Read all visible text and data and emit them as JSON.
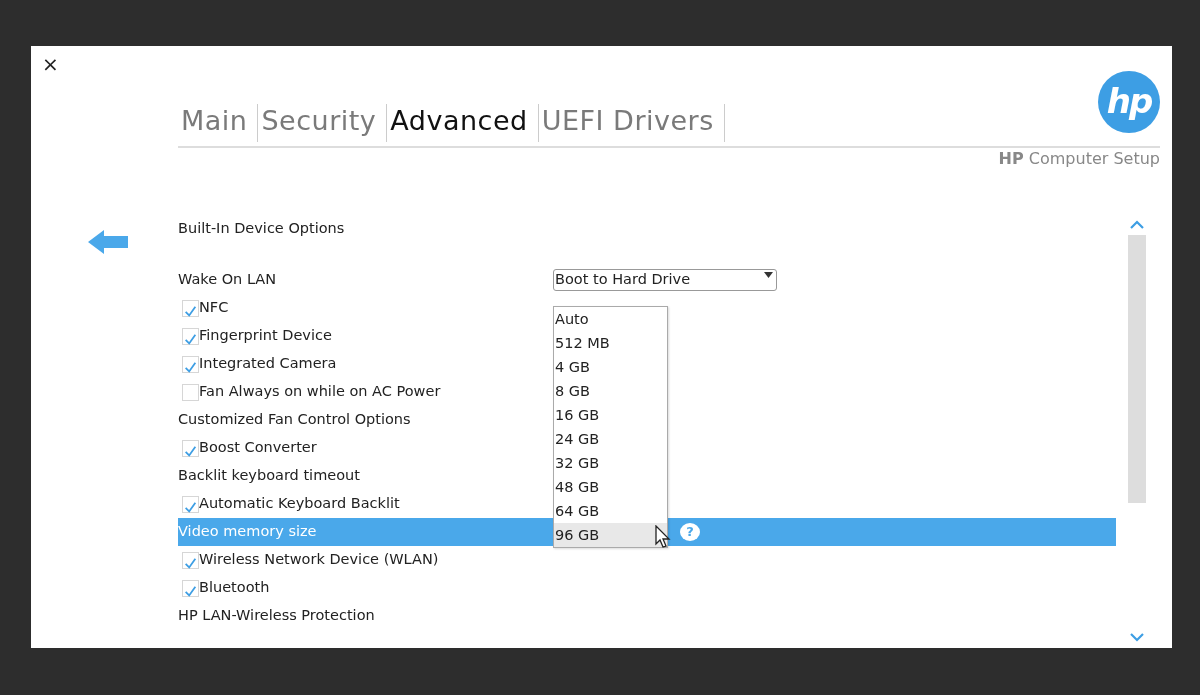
{
  "window": {
    "close": "×"
  },
  "tabs": [
    {
      "label": "Main",
      "selected": false
    },
    {
      "label": "Security",
      "selected": false
    },
    {
      "label": "Advanced",
      "selected": true
    },
    {
      "label": "UEFI Drivers",
      "selected": false
    }
  ],
  "brand": {
    "logo": "hp",
    "subtitle": "**HP** Computer Setup"
  },
  "section_title": "Built-In Device Options",
  "settings": [
    {
      "kind": "dropdown",
      "label": "Wake On LAN",
      "value": "Boot to Hard Drive",
      "selected": false
    },
    {
      "kind": "checkbox",
      "label": "NFC",
      "checked": true,
      "selected": false
    },
    {
      "kind": "checkbox",
      "label": "Fingerprint Device",
      "checked": true,
      "selected": false
    },
    {
      "kind": "checkbox",
      "label": "Integrated Camera",
      "checked": true,
      "selected": false
    },
    {
      "kind": "checkbox",
      "label": "Fan Always on while on AC Power",
      "checked": false,
      "selected": false
    },
    {
      "kind": "heading",
      "label": "Customized Fan Control Options",
      "selected": false
    },
    {
      "kind": "checkbox",
      "label": "Boost Converter",
      "checked": true,
      "selected": false
    },
    {
      "kind": "heading",
      "label": "Backlit keyboard timeout",
      "selected": false
    },
    {
      "kind": "checkbox",
      "label": "Automatic Keyboard Backlit",
      "checked": true,
      "selected": false
    },
    {
      "kind": "heading",
      "label": "Video memory size",
      "selected": true,
      "help": "?"
    },
    {
      "kind": "checkbox",
      "label": "Wireless Network Device (WLAN)",
      "checked": true,
      "selected": false
    },
    {
      "kind": "checkbox",
      "label": "Bluetooth",
      "checked": true,
      "selected": false
    },
    {
      "kind": "heading",
      "label": "HP LAN-Wireless Protection",
      "selected": false
    }
  ],
  "dropdown_list": {
    "options": [
      {
        "label": "Auto",
        "selected": false
      },
      {
        "label": "512 MB",
        "selected": false
      },
      {
        "label": "4 GB",
        "selected": false
      },
      {
        "label": "8 GB",
        "selected": false
      },
      {
        "label": "16 GB",
        "selected": false
      },
      {
        "label": "24 GB",
        "selected": false
      },
      {
        "label": "32 GB",
        "selected": false
      },
      {
        "label": "48 GB",
        "selected": false
      },
      {
        "label": "64 GB",
        "selected": false
      },
      {
        "label": "96 GB",
        "selected": true
      }
    ]
  }
}
